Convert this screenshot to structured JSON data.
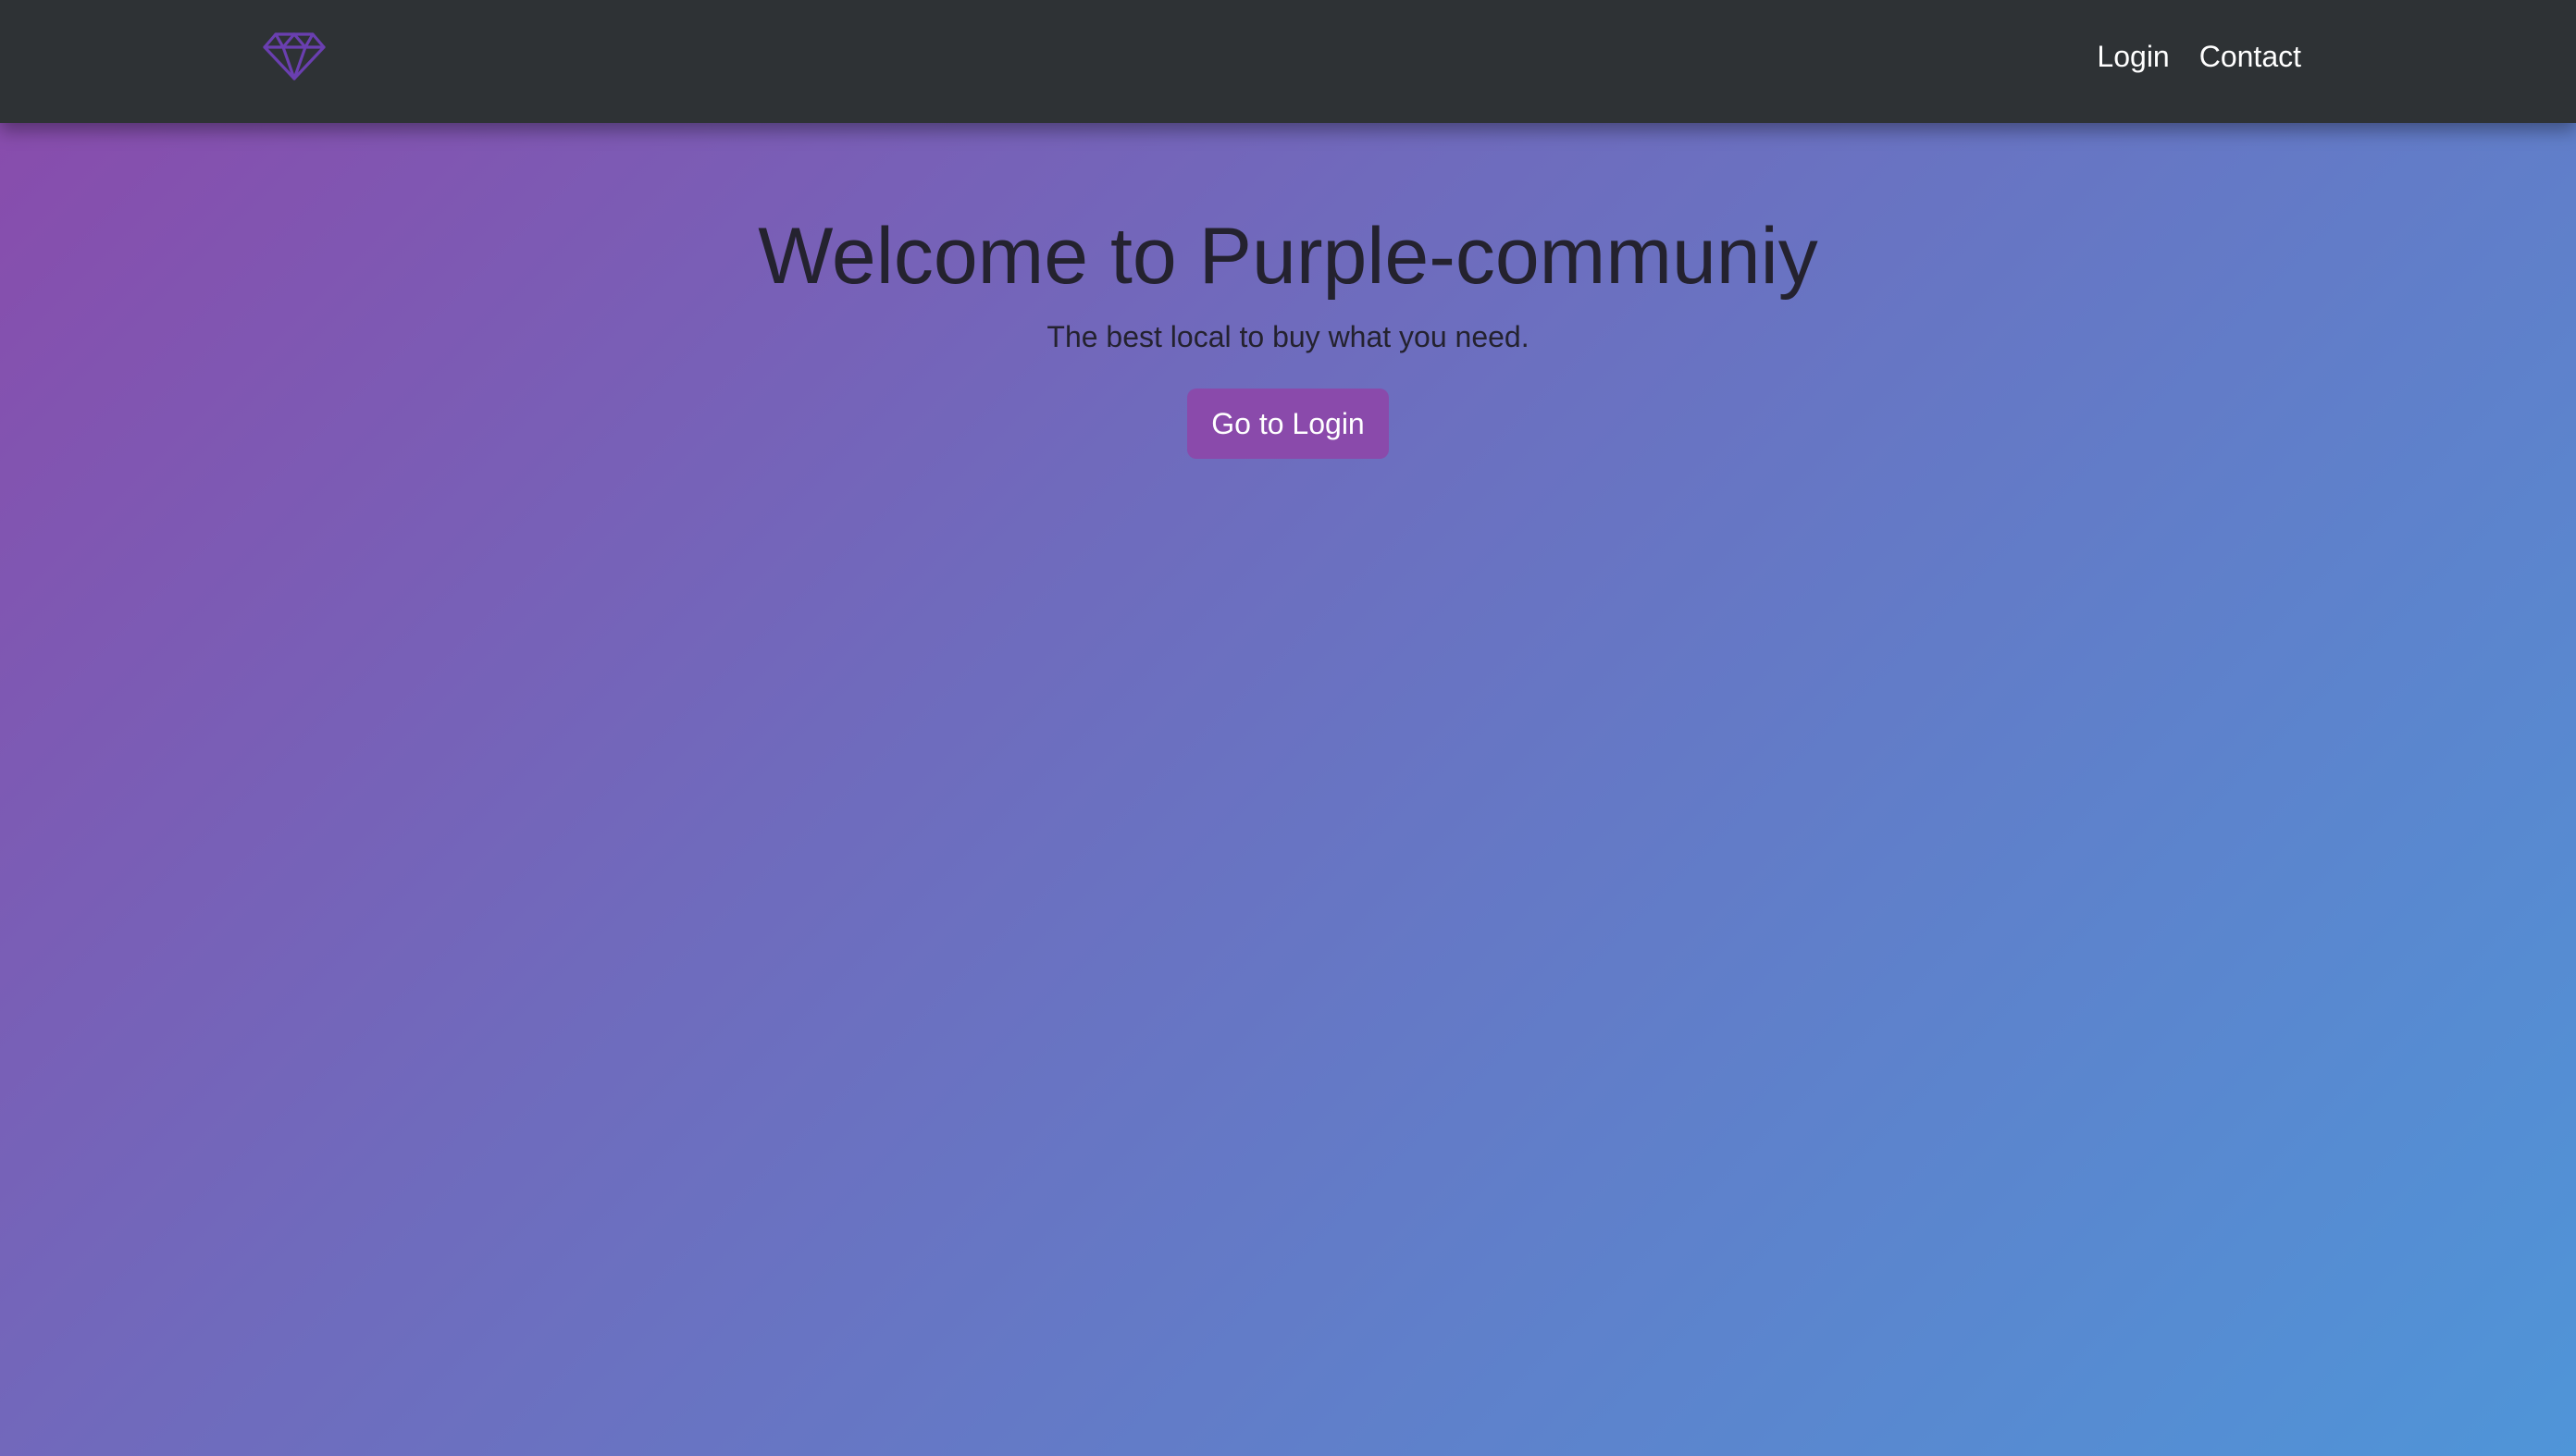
{
  "colors": {
    "navbar_bg": "#2e3235",
    "gradient_start": "#8a4aab",
    "gradient_end": "#4f95d8",
    "accent": "#8a4aab",
    "brand_icon": "#6a3fb0",
    "text_dark": "#24222f",
    "text_light": "#ffffff"
  },
  "navbar": {
    "brand_icon": "diamond-icon",
    "links": [
      {
        "label": "Login"
      },
      {
        "label": "Contact"
      }
    ]
  },
  "hero": {
    "title": "Welcome to Purple-communiy",
    "subtitle": "The best local to buy what you need.",
    "button_label": "Go to Login"
  }
}
